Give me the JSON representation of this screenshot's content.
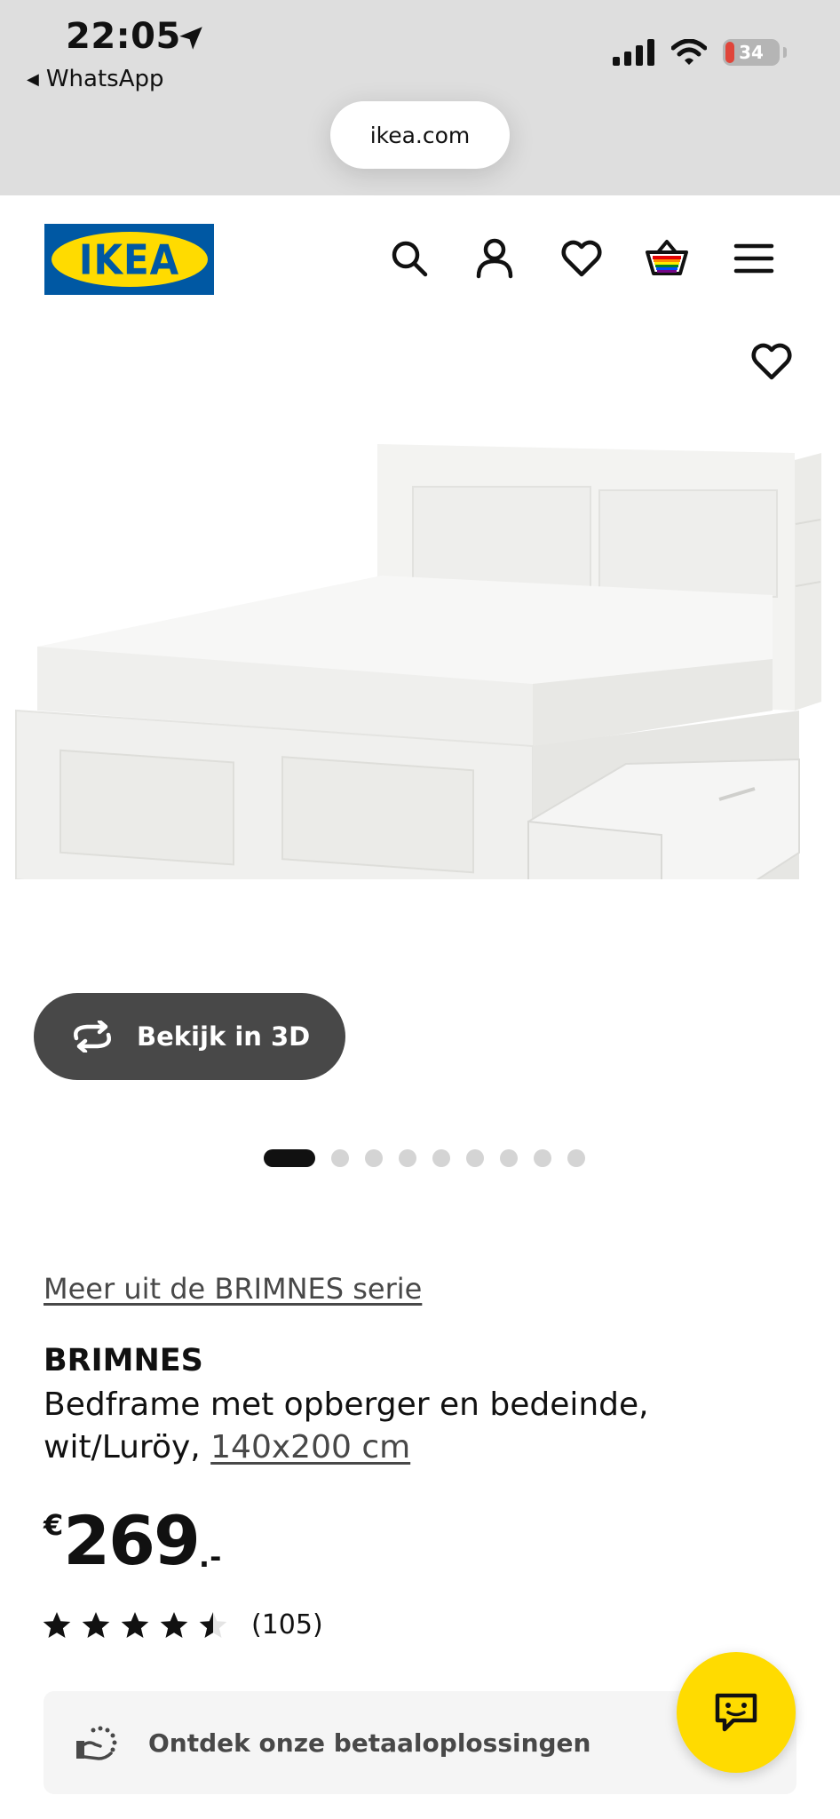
{
  "status_bar": {
    "time": "22:05",
    "back_app": "WhatsApp",
    "battery": "34"
  },
  "browser": {
    "url": "ikea.com"
  },
  "header": {
    "logo_text": "IKEA",
    "icons": [
      "search-icon",
      "account-icon",
      "heart-icon",
      "basket-icon",
      "menu-icon"
    ]
  },
  "gallery": {
    "view_3d_label": "Bekijk in 3D",
    "image_count": 9,
    "active_index": 0
  },
  "product": {
    "series_link": "Meer uit de BRIMNES serie",
    "name": "BRIMNES",
    "description": "Bedframe met opberger en bedeinde, wit/Luröy, ",
    "size": "140x200 cm",
    "currency": "€",
    "price": "269",
    "price_suffix": ".-",
    "rating": 4.5,
    "rating_max": 5,
    "review_count": "(105)"
  },
  "payment": {
    "label": "Ontdek onze betaaloplossingen"
  },
  "colors": {
    "ikea_blue": "#0058a3",
    "ikea_yellow": "#ffdb00",
    "button_dark": "#484848"
  }
}
